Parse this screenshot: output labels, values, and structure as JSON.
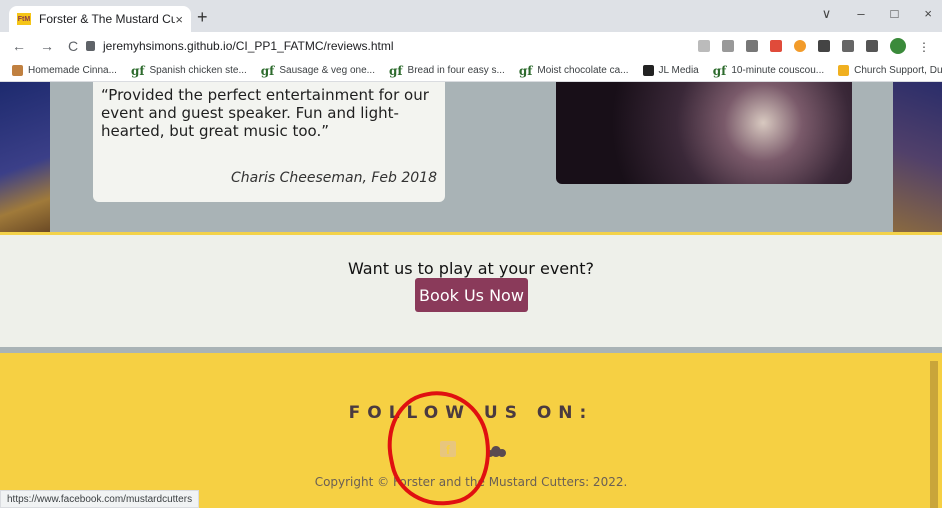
{
  "browser": {
    "tab_title": "Forster & The Mustard Cutters",
    "tab_favicon_text": "FtM",
    "tab_close": "×",
    "new_tab": "+",
    "url": "jeremyhsimons.github.io/CI_PP1_FATMC/reviews.html",
    "win_min": "–",
    "win_max": "□",
    "win_close": "×",
    "win_dropdown": "∨",
    "back": "←",
    "forward": "→",
    "reload": "C",
    "bookmarks": [
      {
        "label": "Homemade Cinna...",
        "icon": "flower-icon"
      },
      {
        "label": "Spanish chicken ste...",
        "icon": "gf-icon",
        "prefix": "gf"
      },
      {
        "label": "Sausage & veg one...",
        "icon": "gf-icon",
        "prefix": "gf"
      },
      {
        "label": "Bread in four easy s...",
        "icon": "gf-icon",
        "prefix": "gf"
      },
      {
        "label": "Moist chocolate ca...",
        "icon": "gf-icon",
        "prefix": "gf"
      },
      {
        "label": "JL Media",
        "icon": "jl-icon"
      },
      {
        "label": "10-minute couscou...",
        "icon": "gf-icon",
        "prefix": "gf"
      },
      {
        "label": "Church Support, Du...",
        "icon": "church-icon"
      }
    ],
    "bookmarks_more": "»",
    "status_url": "https://www.facebook.com/mustardcutters"
  },
  "review": {
    "quote": "“Provided the perfect entertainment for our event and guest speaker. Fun and light-hearted, but great music too.”",
    "author": "Charis Cheeseman, Feb 2018"
  },
  "cta": {
    "question": "Want us to play at your event?",
    "button": "Book Us Now"
  },
  "footer": {
    "follow": "FOLLOW US ON:",
    "facebook_glyph": "f",
    "copyright": "Copyright © Forster and the Mustard Cutters: 2022."
  },
  "colors": {
    "accent": "#8a3a5a",
    "footer_bg": "#f6d043",
    "annotation": "#e01010"
  }
}
